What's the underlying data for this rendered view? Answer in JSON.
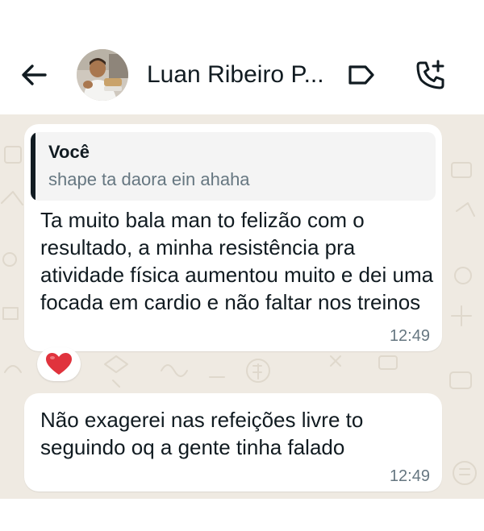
{
  "header": {
    "contact_name": "Luan Ribeiro P...",
    "back_icon": "arrow-left-icon",
    "label_icon": "label-tag-icon",
    "call_icon": "add-call-icon"
  },
  "messages": [
    {
      "quote_author": "Você",
      "quote_text": "shape ta daora ein ahaha",
      "text": "Ta muito bala man to felizão com o resultado, a minha resistência pra atividade física aumentou muito e dei uma focada em cardio e não faltar nos treinos",
      "time": "12:49",
      "reaction": "❤️"
    },
    {
      "text": "Não exagerei nas refeições livre to seguindo oq a gente tinha falado",
      "time": "12:49"
    }
  ],
  "colors": {
    "chat_background": "#efeae2",
    "bubble": "#ffffff",
    "quote_background": "#f4f4f4",
    "text_primary": "#111b21",
    "text_secondary": "#667781",
    "reaction_heart": "#e0333d"
  }
}
